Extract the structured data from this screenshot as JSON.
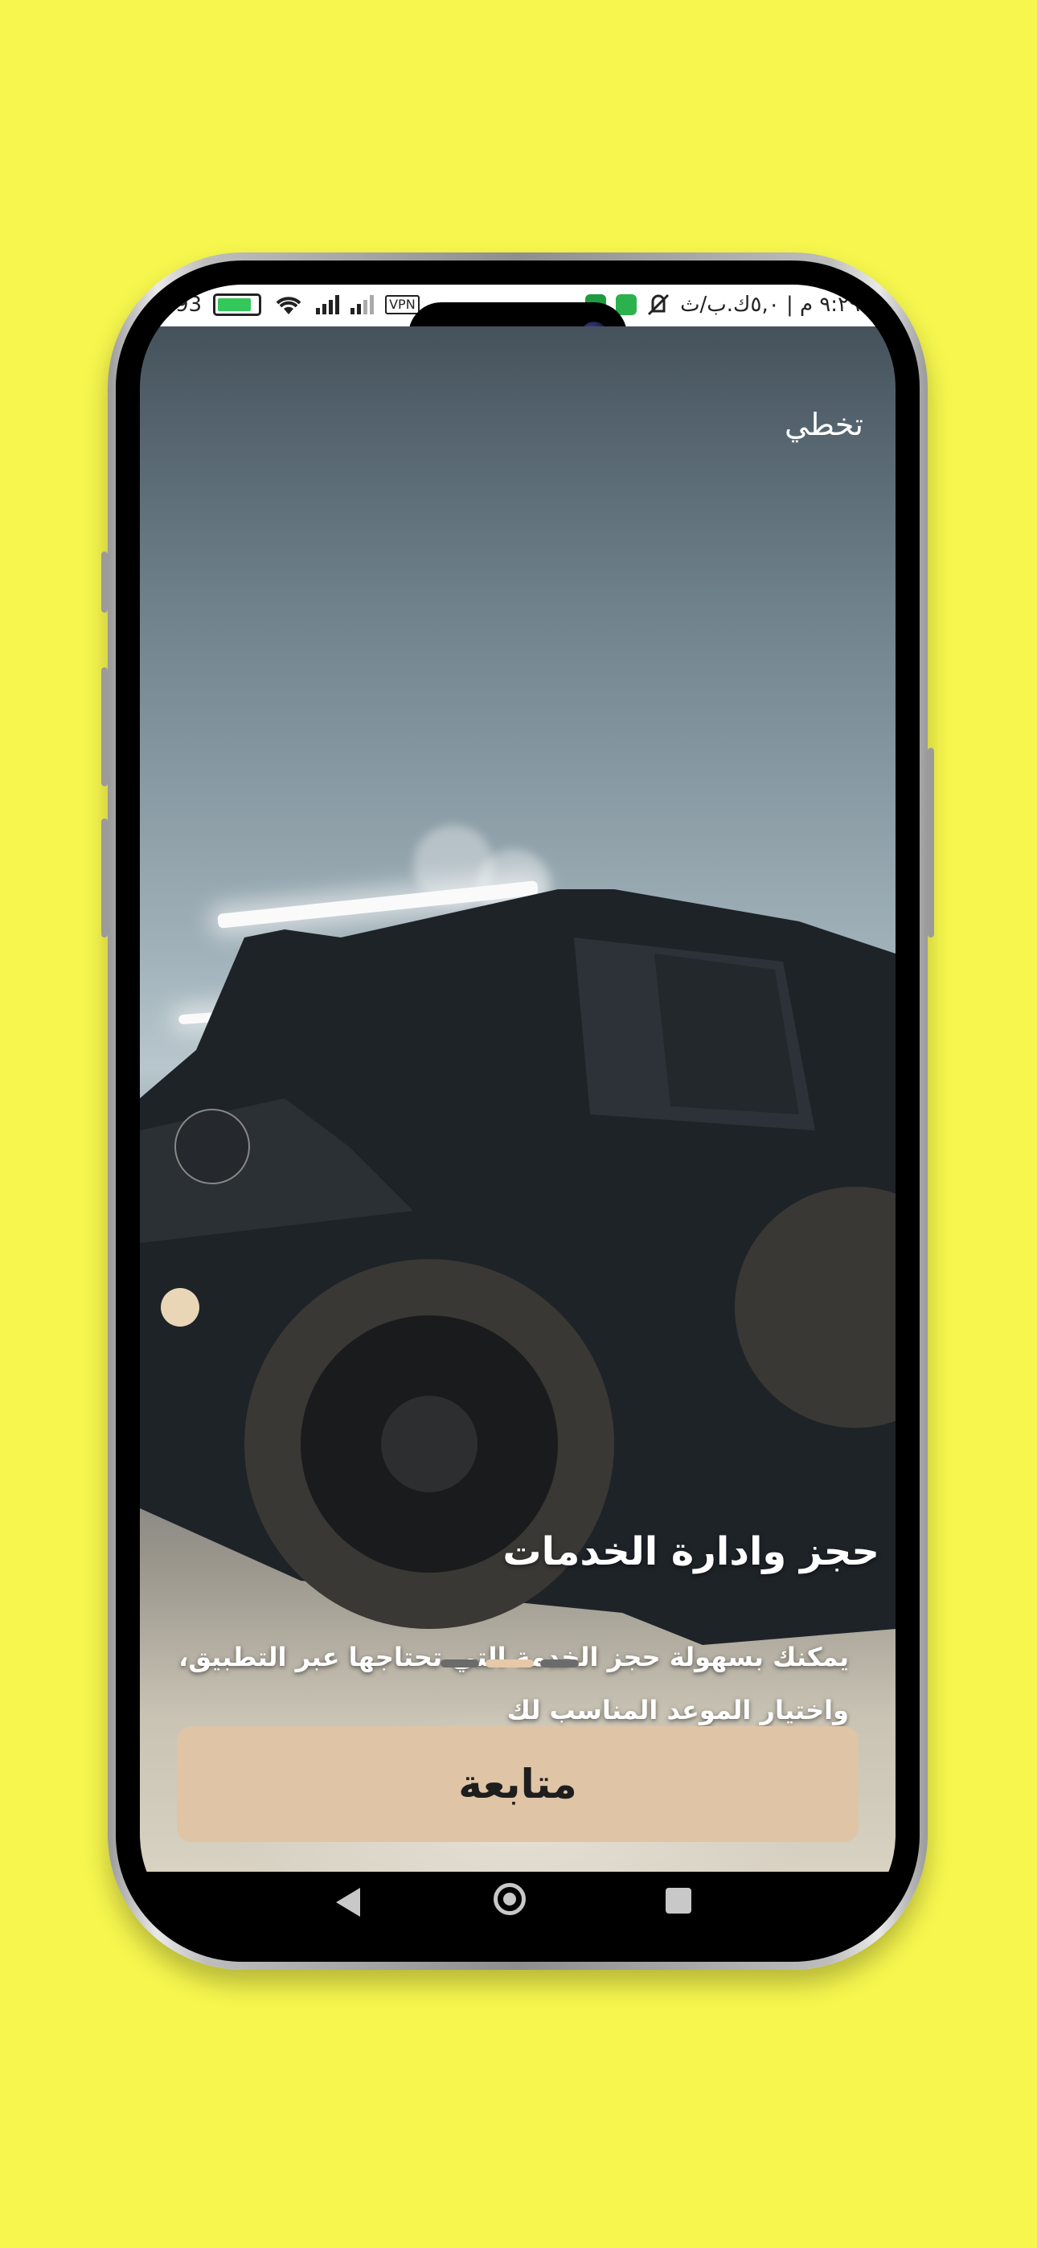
{
  "status_bar": {
    "battery_level": "93",
    "vpn_label": "VPN",
    "right_text": "٩:٢٩ م | ٥,٠ك.ب/ث"
  },
  "header": {
    "skip_label": "تخطي"
  },
  "onboarding": {
    "title": "حجز وادارة الخدمات",
    "description_line1": "يمكنك بسهولة حجز الخدمة التي تحتاجها عبر التطبيق،",
    "description_line2": "واختيار الموعد المناسب لك",
    "page_indicator": {
      "total": 3,
      "active_index": 1
    },
    "continue_label": "متابعة"
  },
  "colors": {
    "background": "#f6f64e",
    "button": "#dfc4a6",
    "active_dot": "#e6c9a8"
  },
  "nav_icons": [
    "back-icon",
    "home-icon",
    "recent-apps-icon"
  ]
}
